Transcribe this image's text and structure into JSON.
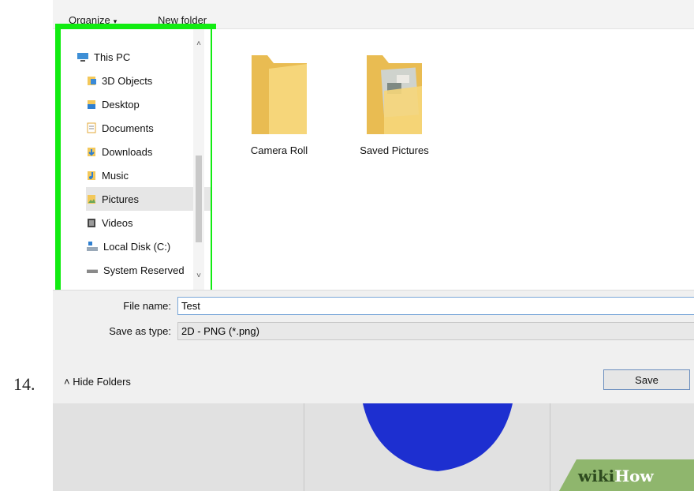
{
  "step_number": "14.",
  "toolbar": {
    "organize_label": "Organize",
    "organize_arrow": "▾",
    "new_folder_label": "New folder"
  },
  "nav": {
    "items": [
      {
        "label": "This PC",
        "icon": "this-pc-icon",
        "selected": false
      },
      {
        "label": "3D Objects",
        "icon": "3d-objects-icon",
        "selected": false
      },
      {
        "label": "Desktop",
        "icon": "desktop-icon",
        "selected": false
      },
      {
        "label": "Documents",
        "icon": "documents-icon",
        "selected": false
      },
      {
        "label": "Downloads",
        "icon": "downloads-icon",
        "selected": false
      },
      {
        "label": "Music",
        "icon": "music-icon",
        "selected": false
      },
      {
        "label": "Pictures",
        "icon": "pictures-icon",
        "selected": true
      },
      {
        "label": "Videos",
        "icon": "videos-icon",
        "selected": false
      },
      {
        "label": "Local Disk (C:)",
        "icon": "local-disk-icon",
        "selected": false
      },
      {
        "label": "System Reserved",
        "icon": "system-reserved-icon",
        "selected": false
      }
    ],
    "highlight_color": "#11ec11"
  },
  "folders": [
    {
      "label": "Camera Roll",
      "icon": "folder-icon"
    },
    {
      "label": "Saved Pictures",
      "icon": "folder-with-picture-icon"
    }
  ],
  "form": {
    "file_name_label": "File name:",
    "file_name_value": "Test",
    "save_as_type_label": "Save as type:",
    "save_as_type_value": "2D - PNG (*.png)"
  },
  "footer": {
    "hide_folders_label": "Hide Folders",
    "save_label": "Save"
  },
  "watermark": {
    "part1": "wiki",
    "part2": "How"
  },
  "colors": {
    "accent_green": "#11ec11",
    "brush_blue": "#1d2fd0",
    "folder_yellow": "#f2ce6a"
  }
}
